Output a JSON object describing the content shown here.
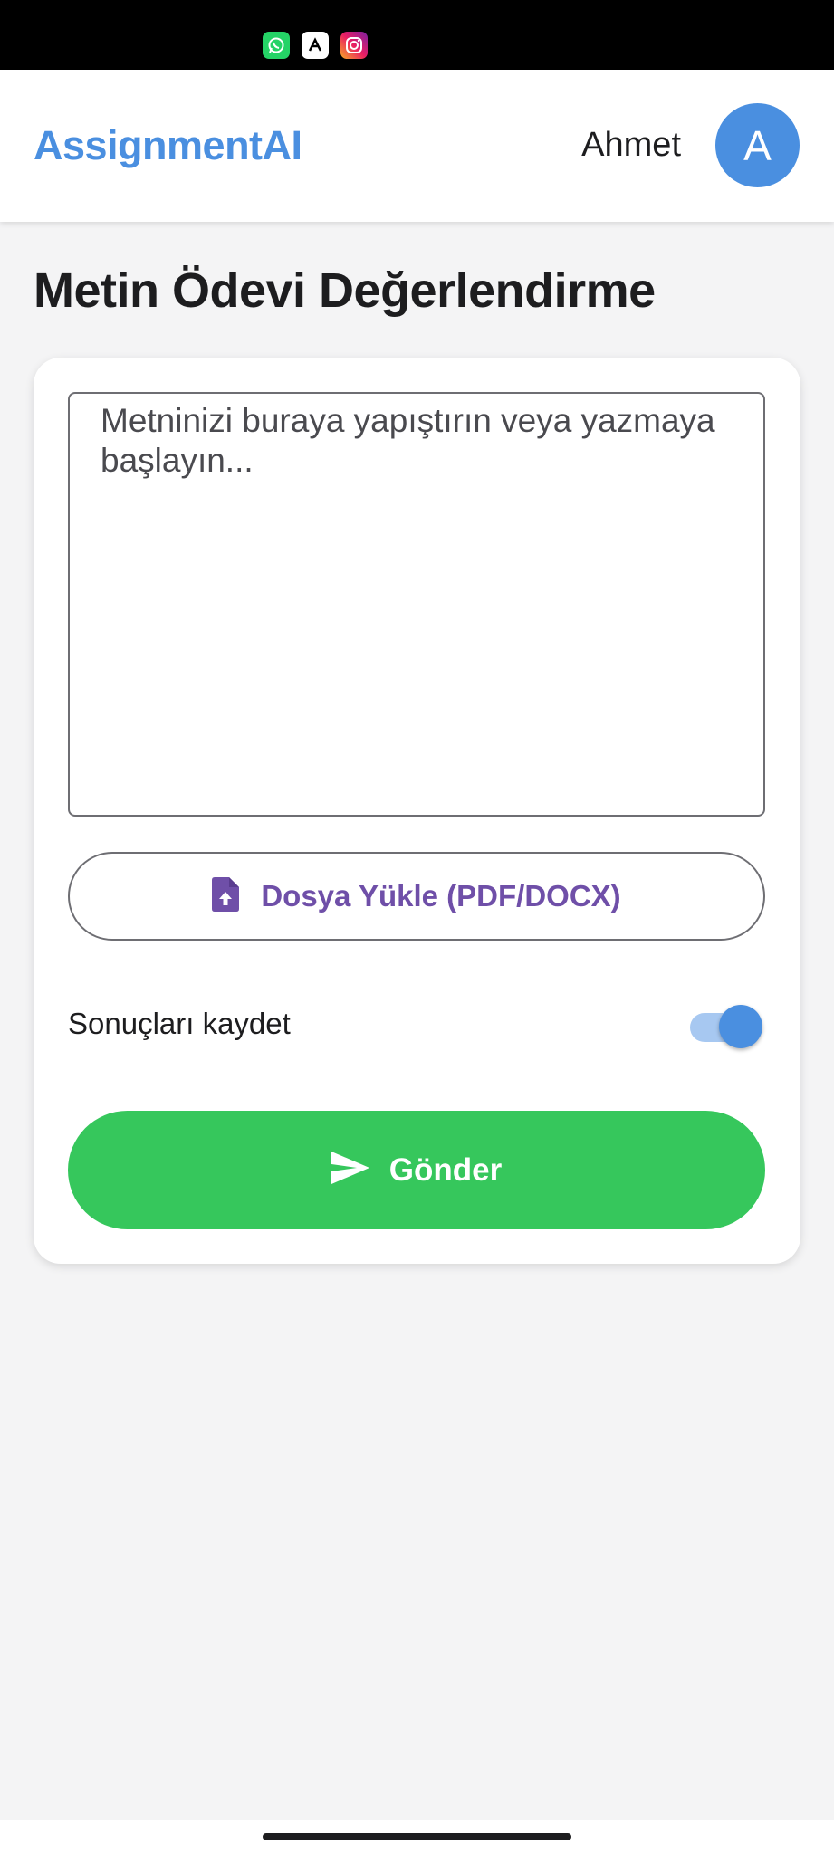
{
  "status_bar": {
    "notifications": [
      "whatsapp-icon",
      "app-icon",
      "instagram-icon"
    ]
  },
  "header": {
    "brand": "AssignmentAI",
    "user_name": "Ahmet",
    "avatar_initial": "A"
  },
  "page": {
    "title": "Metin Ödevi Değerlendirme"
  },
  "form": {
    "text_placeholder": "Metninizi buraya yapıştırın veya yazmaya başlayın...",
    "text_value": "",
    "upload_label": "Dosya Yükle (PDF/DOCX)",
    "upload_icon": "file-upload-icon",
    "save_results_label": "Sonuçları kaydet",
    "save_results_on": true,
    "submit_label": "Gönder",
    "submit_icon": "send-icon"
  },
  "colors": {
    "brand": "#4a8fe0",
    "accent_purple": "#6f4fa8",
    "submit_green": "#36c75c",
    "toggle_on": "#4a8fe0"
  }
}
